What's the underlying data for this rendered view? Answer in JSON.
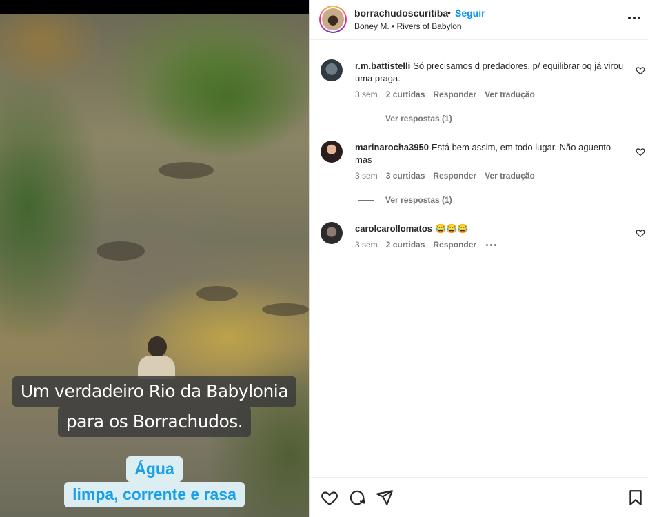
{
  "post": {
    "owner": "borrachudoscuritiba",
    "separator": "•",
    "follow_label": "Seguir",
    "audio": "Boney M. • Rivers of Babylon"
  },
  "captions": {
    "line1": "Um verdadeiro Rio da Babylonia",
    "line2": "para os Borrachudos.",
    "line3": "Água",
    "line4": "limpa, corrente e rasa"
  },
  "comments": [
    {
      "user": "r.m.battistelli",
      "text": "Só precisamos d predadores, p/ equilibrar oq já virou uma praga.",
      "time": "3 sem",
      "likes": "2 curtidas",
      "reply": "Responder",
      "translate": "Ver tradução",
      "view_replies": "Ver respostas (1)"
    },
    {
      "user": "marinarocha3950",
      "text": "Está bem assim, em todo lugar. Não aguento mas",
      "time": "3 sem",
      "likes": "3 curtidas",
      "reply": "Responder",
      "translate": "Ver tradução",
      "view_replies": "Ver respostas (1)"
    },
    {
      "user": "carolcarollomatos",
      "text": "😂😂😂",
      "time": "3 sem",
      "likes": "2 curtidas",
      "reply": "Responder"
    }
  ],
  "icons": {
    "like": "heart-icon",
    "comment": "comment-icon",
    "share": "share-icon",
    "save": "bookmark-icon",
    "more": "more-horizontal-icon"
  },
  "colors": {
    "accent": "#0095f6",
    "caption_light_text": "#1aa0e8"
  }
}
